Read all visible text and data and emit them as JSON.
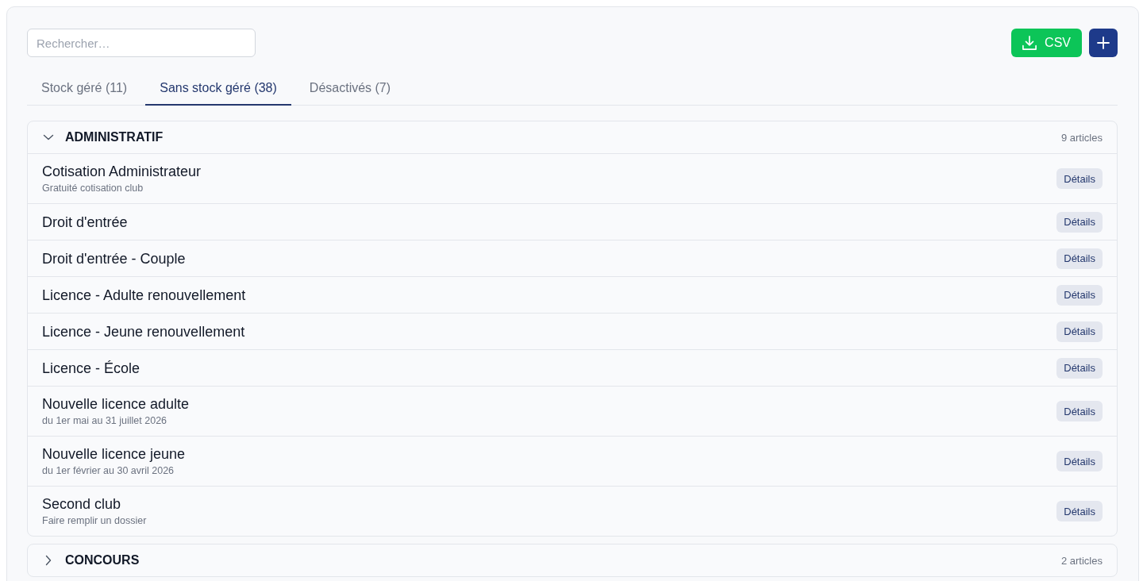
{
  "search": {
    "placeholder": "Rechercher…"
  },
  "actions": [
    {
      "kind": "export",
      "label": "CSV"
    },
    {
      "kind": "add"
    }
  ],
  "tabs": [
    {
      "label": "Stock géré (11)",
      "selected": false
    },
    {
      "label": "Sans stock géré (38)",
      "selected": true
    },
    {
      "label": "Désactivés (7)",
      "selected": false
    }
  ],
  "groups": [
    {
      "title": "ADMINISTRATIF",
      "count": "9 articles",
      "expanded": true,
      "items": [
        {
          "name": "Cotisation Administrateur",
          "note": "Gratuité cotisation club",
          "action": "Détails"
        },
        {
          "name": "Droit d'entrée",
          "action": "Détails"
        },
        {
          "name": "Droit d'entrée - Couple",
          "action": "Détails"
        },
        {
          "name": "Licence - Adulte renouvellement",
          "action": "Détails"
        },
        {
          "name": "Licence - Jeune renouvellement",
          "action": "Détails"
        },
        {
          "name": "Licence - École",
          "action": "Détails"
        },
        {
          "name": "Nouvelle licence adulte",
          "note": "du 1er mai au 31 juillet 2026",
          "action": "Détails"
        },
        {
          "name": "Nouvelle licence jeune",
          "note": "du 1er février au 30 avril 2026",
          "action": "Détails"
        },
        {
          "name": "Second club",
          "note": "Faire remplir un dossier",
          "action": "Détails"
        }
      ]
    },
    {
      "title": "CONCOURS",
      "count": "2 articles",
      "expanded": false
    }
  ]
}
